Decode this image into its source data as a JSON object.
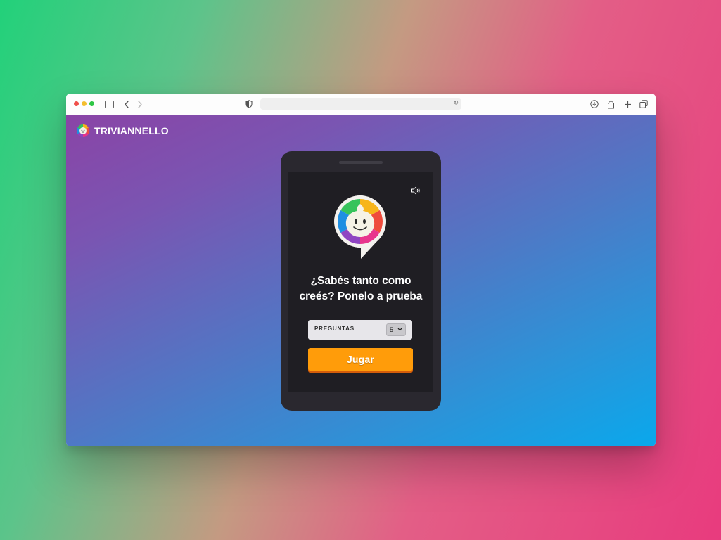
{
  "browser": {
    "url": "",
    "icons": [
      "sidebar-icon",
      "back-icon",
      "forward-icon",
      "shield-icon",
      "reload-icon",
      "download-icon",
      "share-icon",
      "new-tab-icon",
      "tabs-overview-icon"
    ]
  },
  "brand": {
    "name": "TRIVIANNELLO"
  },
  "game": {
    "headline_line1": "¿Sabés tanto como",
    "headline_line2": "creés? Ponelo a prueba",
    "questions_label": "PREGUNTAS",
    "questions_value": "5",
    "play_label": "Jugar"
  },
  "colors": {
    "play_button": "#ff9c0a",
    "phone_body": "#2a282f",
    "screen_bg": "#1f1e23"
  }
}
